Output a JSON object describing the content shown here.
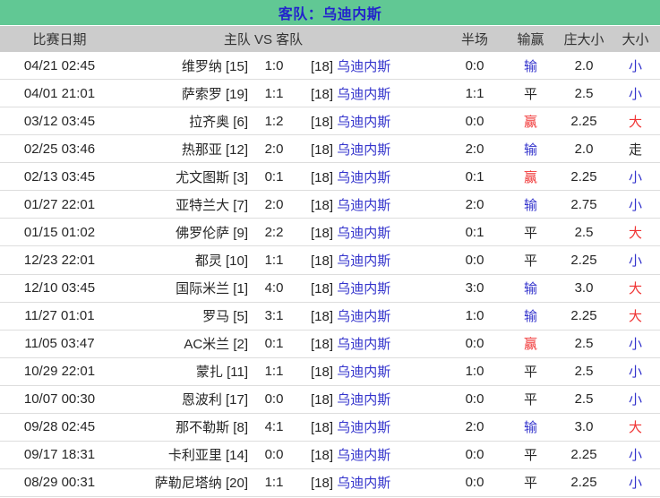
{
  "title": {
    "label": "客队：乌迪内斯"
  },
  "colors": {
    "title_bg": "#61C894",
    "title_text": "#2323CC",
    "header_bg": "#CCCCCC",
    "header_text": "#333333",
    "text_dark": "#262626",
    "blue": "#3333CC",
    "red": "#F03434",
    "row_border": "#DDDDDD"
  },
  "table": {
    "headers": {
      "date": "比赛日期",
      "match": "主队 VS 客队",
      "half": "半场",
      "result": "输赢",
      "ou_line": "庄大小",
      "ou": "大小"
    },
    "result_colors": {
      "输": "#3333CC",
      "平": "#262626",
      "赢": "#F03434"
    },
    "ou_colors": {
      "小": "#3333CC",
      "大": "#F03434",
      "走": "#262626"
    },
    "rows": [
      {
        "date": "04/21 02:45",
        "home": "维罗纳",
        "home_rank": "[15]",
        "score": "1:0",
        "away_rank": "[18]",
        "away": "乌迪内斯",
        "half": "0:0",
        "result": "输",
        "ou_line": "2.0",
        "ou": "小"
      },
      {
        "date": "04/01 21:01",
        "home": "萨索罗",
        "home_rank": "[19]",
        "score": "1:1",
        "away_rank": "[18]",
        "away": "乌迪内斯",
        "half": "1:1",
        "result": "平",
        "ou_line": "2.5",
        "ou": "小"
      },
      {
        "date": "03/12 03:45",
        "home": "拉齐奥",
        "home_rank": "[6]",
        "score": "1:2",
        "away_rank": "[18]",
        "away": "乌迪内斯",
        "half": "0:0",
        "result": "赢",
        "ou_line": "2.25",
        "ou": "大"
      },
      {
        "date": "02/25 03:46",
        "home": "热那亚",
        "home_rank": "[12]",
        "score": "2:0",
        "away_rank": "[18]",
        "away": "乌迪内斯",
        "half": "2:0",
        "result": "输",
        "ou_line": "2.0",
        "ou": "走"
      },
      {
        "date": "02/13 03:45",
        "home": "尤文图斯",
        "home_rank": "[3]",
        "score": "0:1",
        "away_rank": "[18]",
        "away": "乌迪内斯",
        "half": "0:1",
        "result": "赢",
        "ou_line": "2.25",
        "ou": "小"
      },
      {
        "date": "01/27 22:01",
        "home": "亚特兰大",
        "home_rank": "[7]",
        "score": "2:0",
        "away_rank": "[18]",
        "away": "乌迪内斯",
        "half": "2:0",
        "result": "输",
        "ou_line": "2.75",
        "ou": "小"
      },
      {
        "date": "01/15 01:02",
        "home": "佛罗伦萨",
        "home_rank": "[9]",
        "score": "2:2",
        "away_rank": "[18]",
        "away": "乌迪内斯",
        "half": "0:1",
        "result": "平",
        "ou_line": "2.5",
        "ou": "大"
      },
      {
        "date": "12/23 22:01",
        "home": "都灵",
        "home_rank": "[10]",
        "score": "1:1",
        "away_rank": "[18]",
        "away": "乌迪内斯",
        "half": "0:0",
        "result": "平",
        "ou_line": "2.25",
        "ou": "小"
      },
      {
        "date": "12/10 03:45",
        "home": "国际米兰",
        "home_rank": "[1]",
        "score": "4:0",
        "away_rank": "[18]",
        "away": "乌迪内斯",
        "half": "3:0",
        "result": "输",
        "ou_line": "3.0",
        "ou": "大"
      },
      {
        "date": "11/27 01:01",
        "home": "罗马",
        "home_rank": "[5]",
        "score": "3:1",
        "away_rank": "[18]",
        "away": "乌迪内斯",
        "half": "1:0",
        "result": "输",
        "ou_line": "2.25",
        "ou": "大"
      },
      {
        "date": "11/05 03:47",
        "home": "AC米兰",
        "home_rank": "[2]",
        "score": "0:1",
        "away_rank": "[18]",
        "away": "乌迪内斯",
        "half": "0:0",
        "result": "赢",
        "ou_line": "2.5",
        "ou": "小"
      },
      {
        "date": "10/29 22:01",
        "home": "蒙扎",
        "home_rank": "[11]",
        "score": "1:1",
        "away_rank": "[18]",
        "away": "乌迪内斯",
        "half": "1:0",
        "result": "平",
        "ou_line": "2.5",
        "ou": "小"
      },
      {
        "date": "10/07 00:30",
        "home": "恩波利",
        "home_rank": "[17]",
        "score": "0:0",
        "away_rank": "[18]",
        "away": "乌迪内斯",
        "half": "0:0",
        "result": "平",
        "ou_line": "2.5",
        "ou": "小"
      },
      {
        "date": "09/28 02:45",
        "home": "那不勒斯",
        "home_rank": "[8]",
        "score": "4:1",
        "away_rank": "[18]",
        "away": "乌迪内斯",
        "half": "2:0",
        "result": "输",
        "ou_line": "3.0",
        "ou": "大"
      },
      {
        "date": "09/17 18:31",
        "home": "卡利亚里",
        "home_rank": "[14]",
        "score": "0:0",
        "away_rank": "[18]",
        "away": "乌迪内斯",
        "half": "0:0",
        "result": "平",
        "ou_line": "2.25",
        "ou": "小"
      },
      {
        "date": "08/29 00:31",
        "home": "萨勒尼塔纳",
        "home_rank": "[20]",
        "score": "1:1",
        "away_rank": "[18]",
        "away": "乌迪内斯",
        "half": "0:0",
        "result": "平",
        "ou_line": "2.25",
        "ou": "小"
      }
    ]
  }
}
